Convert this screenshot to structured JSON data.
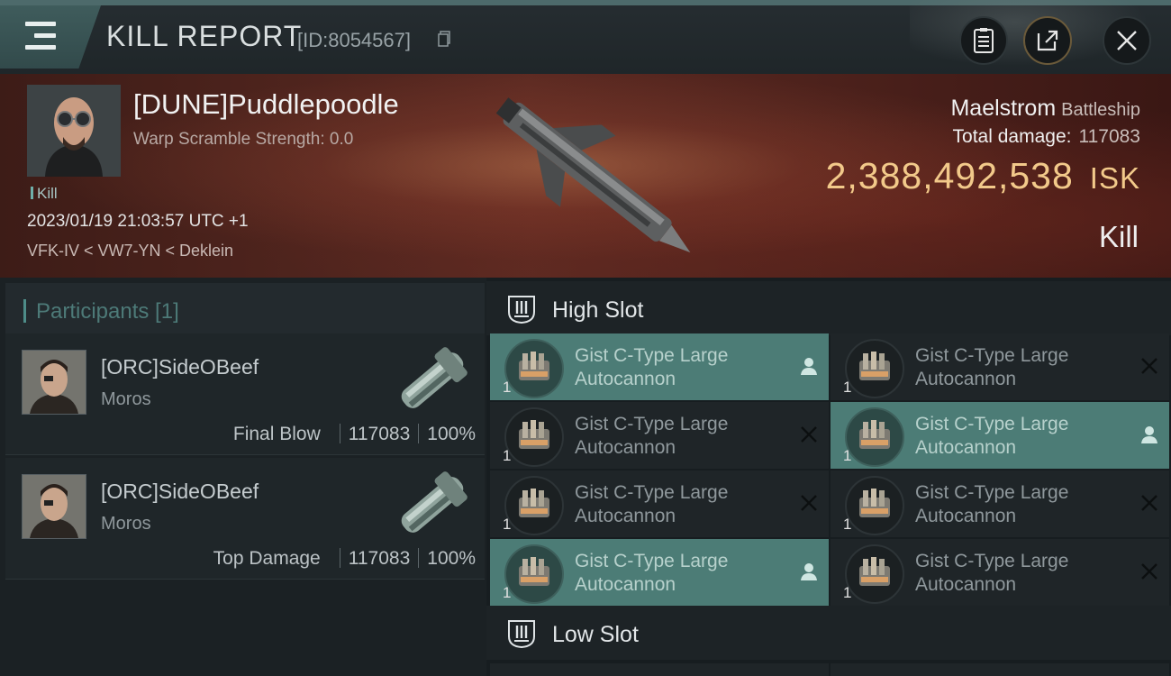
{
  "header": {
    "title": "KILL REPORT",
    "id_text": "[ID:8054567]",
    "buttons": [
      "clipboard-icon",
      "share-icon",
      "close-icon"
    ]
  },
  "victim": {
    "name": "[DUNE]Puddlepoodle",
    "scramble": "Warp Scramble Strength: 0.0",
    "tag": "Kill",
    "date": "2023/01/19 21:03:57 UTC +1",
    "location": "VFK-IV < VW7-YN < Deklein",
    "ship": "Maelstrom",
    "ship_class": "Battleship",
    "damage_label": "Total damage:",
    "damage_value": "117083",
    "isk_value": "2,388,492,538",
    "isk_unit": "ISK",
    "result": "Kill"
  },
  "participants": {
    "title": "Participants [1]",
    "rows": [
      {
        "name": "[ORC]SideOBeef",
        "ship": "Moros",
        "role": "Final Blow",
        "damage": "117083",
        "percent": "100%"
      },
      {
        "name": "[ORC]SideOBeef",
        "ship": "Moros",
        "role": "Top Damage",
        "damage": "117083",
        "percent": "100%"
      }
    ]
  },
  "fitting": {
    "high_slot_title": "High Slot",
    "low_slot_title": "Low Slot",
    "modules": [
      {
        "name_line1": "Gist C-Type Large",
        "name_line2": "Autocannon",
        "qty": "1",
        "status": "dropped"
      },
      {
        "name_line1": "Gist C-Type Large",
        "name_line2": "Autocannon",
        "qty": "1",
        "status": "destroyed"
      },
      {
        "name_line1": "Gist C-Type Large",
        "name_line2": "Autocannon",
        "qty": "1",
        "status": "destroyed"
      },
      {
        "name_line1": "Gist C-Type Large",
        "name_line2": "Autocannon",
        "qty": "1",
        "status": "dropped"
      },
      {
        "name_line1": "Gist C-Type Large",
        "name_line2": "Autocannon",
        "qty": "1",
        "status": "destroyed"
      },
      {
        "name_line1": "Gist C-Type Large",
        "name_line2": "Autocannon",
        "qty": "1",
        "status": "destroyed"
      },
      {
        "name_line1": "Gist C-Type Large",
        "name_line2": "Autocannon",
        "qty": "1",
        "status": "dropped"
      },
      {
        "name_line1": "Gist C-Type Large",
        "name_line2": "Autocannon",
        "qty": "1",
        "status": "destroyed"
      }
    ]
  },
  "colors": {
    "accent": "#4c7c76",
    "isk": "#f2c98a",
    "background": "#1c2226"
  }
}
